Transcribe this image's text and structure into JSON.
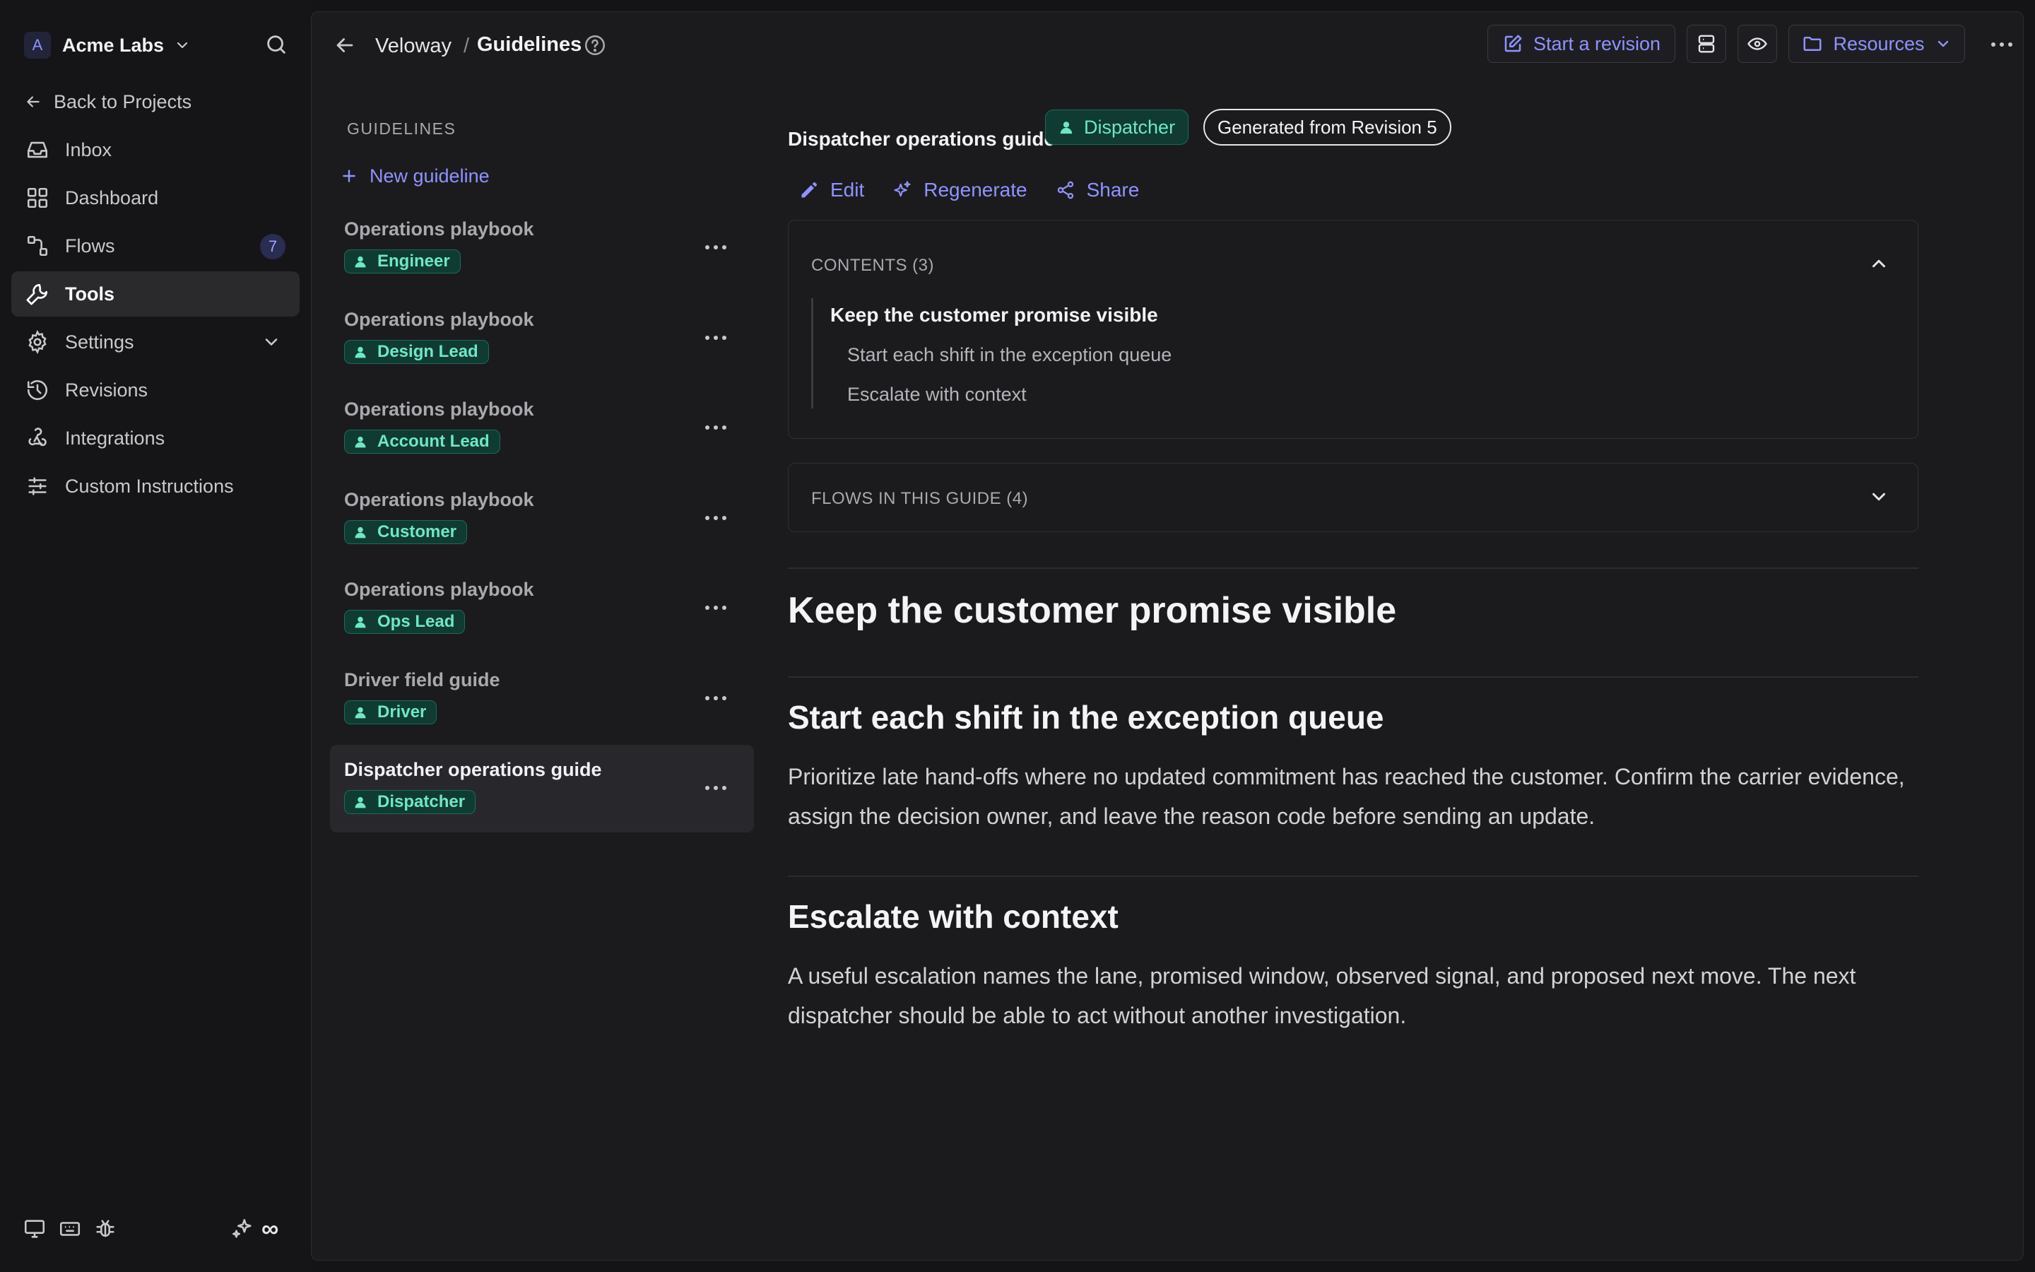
{
  "workspace": {
    "initial": "A",
    "name": "Acme Labs"
  },
  "sidebar": {
    "back_label": "Back to Projects",
    "items": [
      {
        "label": "Inbox",
        "icon": "inbox-icon"
      },
      {
        "label": "Dashboard",
        "icon": "dashboard-icon"
      },
      {
        "label": "Flows",
        "icon": "flows-icon",
        "badge": "7"
      },
      {
        "label": "Tools",
        "icon": "wrench-icon",
        "active": true
      },
      {
        "label": "Settings",
        "icon": "gear-icon",
        "expandable": true
      },
      {
        "label": "Revisions",
        "icon": "history-icon"
      },
      {
        "label": "Integrations",
        "icon": "webhook-icon"
      },
      {
        "label": "Custom Instructions",
        "icon": "sliders-icon"
      }
    ],
    "footer": {
      "loop_symbol": "∞"
    }
  },
  "topbar": {
    "breadcrumb": [
      "Veloway",
      "Guidelines"
    ],
    "separator": "/",
    "start_revision_label": "Start a revision",
    "resources_label": "Resources"
  },
  "guidelines": {
    "heading": "GUIDELINES",
    "new_label": "New guideline",
    "items": [
      {
        "title": "Operations playbook",
        "role": "Engineer"
      },
      {
        "title": "Operations playbook",
        "role": "Design Lead"
      },
      {
        "title": "Operations playbook",
        "role": "Account Lead"
      },
      {
        "title": "Operations playbook",
        "role": "Customer"
      },
      {
        "title": "Operations playbook",
        "role": "Ops Lead"
      },
      {
        "title": "Driver field guide",
        "role": "Driver"
      },
      {
        "title": "Dispatcher operations guide",
        "role": "Dispatcher",
        "active": true
      }
    ]
  },
  "document": {
    "title": "Dispatcher operations guide",
    "role": "Dispatcher",
    "revision_pill": "Generated from Revision 5",
    "actions": {
      "edit": "Edit",
      "regenerate": "Regenerate",
      "share": "Share"
    },
    "contents": {
      "heading": "CONTENTS (3)",
      "items": [
        "Keep the customer promise visible",
        "Start each shift in the exception queue",
        "Escalate with context"
      ]
    },
    "flows_heading": "FLOWS IN THIS GUIDE (4)",
    "sections": {
      "h1": "Keep the customer promise visible",
      "s1_title": "Start each shift in the exception queue",
      "s1_body": "Prioritize late hand-offs where no updated commitment has reached the customer. Confirm the carrier evidence, assign the decision owner, and leave the reason code before sending an update.",
      "s2_title": "Escalate with context",
      "s2_body": "A useful escalation names the lane, promised window, observed signal, and proposed next move. The next dispatcher should be able to act without another investigation."
    }
  },
  "colors": {
    "accent": "#8f93ff",
    "role_tag_text": "#6ee7c4",
    "role_tag_bg": "#0f3b33",
    "panel_bg": "#1b1b1e",
    "sidebar_bg": "#151517"
  }
}
